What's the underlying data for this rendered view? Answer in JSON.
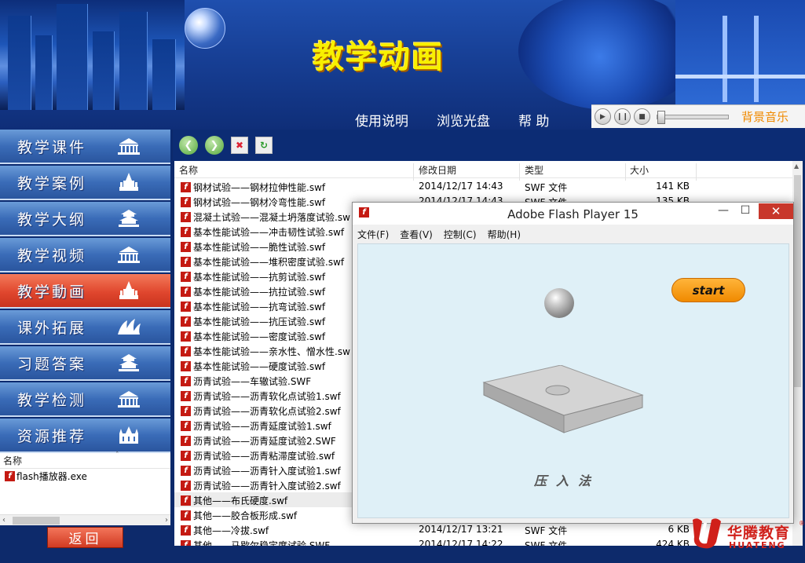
{
  "banner": {
    "title": "教学动画",
    "nav": [
      "使用说明",
      "浏览光盘",
      "帮  助"
    ]
  },
  "player": {
    "label": "背景音乐",
    "volume": 0.0
  },
  "leftnav": {
    "items": [
      {
        "label": "教学课件",
        "icon": "building-icon",
        "active": false
      },
      {
        "label": "教学案例",
        "icon": "palace-icon",
        "active": false
      },
      {
        "label": "教学大纲",
        "icon": "temple-icon",
        "active": false
      },
      {
        "label": "教学视频",
        "icon": "building-icon",
        "active": false
      },
      {
        "label": "教学動画",
        "icon": "palace-icon",
        "active": true
      },
      {
        "label": "课外拓展",
        "icon": "opera-house-icon",
        "active": false
      },
      {
        "label": "习题答案",
        "icon": "temple-icon",
        "active": false
      },
      {
        "label": "教学检测",
        "icon": "building-icon",
        "active": false
      },
      {
        "label": "资源推荐",
        "icon": "cathedral-icon",
        "active": false
      }
    ]
  },
  "leftlist": {
    "header": "名称",
    "rows": [
      "flash播放器.exe"
    ]
  },
  "back_label": "返回",
  "explorer": {
    "columns": {
      "name": "名称",
      "date": "修改日期",
      "type": "类型",
      "size": "大小"
    },
    "rows": [
      {
        "name": "钢材试验——钢材拉伸性能.swf",
        "date": "2014/12/17 14:43",
        "type": "SWF 文件",
        "size": "141 KB"
      },
      {
        "name": "钢材试验——钢材冷弯性能.swf",
        "date": "2014/12/17 14:43",
        "type": "SWF 文件",
        "size": "135 KB"
      },
      {
        "name": "混凝土试验——混凝土坍落度试验.sw",
        "date": "",
        "type": "",
        "size": ""
      },
      {
        "name": "基本性能试验——冲击韧性试验.swf",
        "date": "",
        "type": "",
        "size": ""
      },
      {
        "name": "基本性能试验——脆性试验.swf",
        "date": "",
        "type": "",
        "size": ""
      },
      {
        "name": "基本性能试验——堆积密度试验.swf",
        "date": "",
        "type": "",
        "size": ""
      },
      {
        "name": "基本性能试验——抗剪试验.swf",
        "date": "",
        "type": "",
        "size": ""
      },
      {
        "name": "基本性能试验——抗拉试验.swf",
        "date": "",
        "type": "",
        "size": ""
      },
      {
        "name": "基本性能试验——抗弯试验.swf",
        "date": "",
        "type": "",
        "size": ""
      },
      {
        "name": "基本性能试验——抗压试验.swf",
        "date": "",
        "type": "",
        "size": ""
      },
      {
        "name": "基本性能试验——密度试验.swf",
        "date": "",
        "type": "",
        "size": ""
      },
      {
        "name": "基本性能试验——亲水性、憎水性.sw",
        "date": "",
        "type": "",
        "size": ""
      },
      {
        "name": "基本性能试验——硬度试验.swf",
        "date": "",
        "type": "",
        "size": ""
      },
      {
        "name": "沥青试验——车辙试验.SWF",
        "date": "",
        "type": "",
        "size": ""
      },
      {
        "name": "沥青试验——沥青软化点试验1.swf",
        "date": "",
        "type": "",
        "size": ""
      },
      {
        "name": "沥青试验——沥青软化点试验2.swf",
        "date": "",
        "type": "",
        "size": ""
      },
      {
        "name": "沥青试验——沥青延度试验1.swf",
        "date": "",
        "type": "",
        "size": ""
      },
      {
        "name": "沥青试验——沥青延度试验2.SWF",
        "date": "",
        "type": "",
        "size": ""
      },
      {
        "name": "沥青试验——沥青粘滞度试验.swf",
        "date": "",
        "type": "",
        "size": ""
      },
      {
        "name": "沥青试验——沥青针入度试验1.swf",
        "date": "",
        "type": "",
        "size": ""
      },
      {
        "name": "沥青试验——沥青针入度试验2.swf",
        "date": "",
        "type": "",
        "size": ""
      },
      {
        "name": "其他——布氏硬度.swf",
        "date": "",
        "type": "",
        "size": "",
        "selected": true
      },
      {
        "name": "其他——胶合板形成.swf",
        "date": "",
        "type": "",
        "size": ""
      },
      {
        "name": "其他——冷拔.swf",
        "date": "2014/12/17 13:21",
        "type": "SWF 文件",
        "size": "6 KB"
      },
      {
        "name": "其他——马歇尔稳定度试验.SWF",
        "date": "2014/12/17 14:22",
        "type": "SWF 文件",
        "size": "424 KB"
      }
    ]
  },
  "flash": {
    "title": "Adobe Flash Player 15",
    "menu": [
      "文件(F)",
      "查看(V)",
      "控制(C)",
      "帮助(H)"
    ],
    "start_label": "start",
    "caption": "压入法"
  },
  "logo": {
    "cn": "华腾教育",
    "en": "HUATENG",
    "reg": "®"
  },
  "colors": {
    "accent_red": "#e0472e",
    "nav_blue": "#3a6cb8",
    "title_yellow": "#f8f000",
    "flash_orange": "#f08a00"
  }
}
